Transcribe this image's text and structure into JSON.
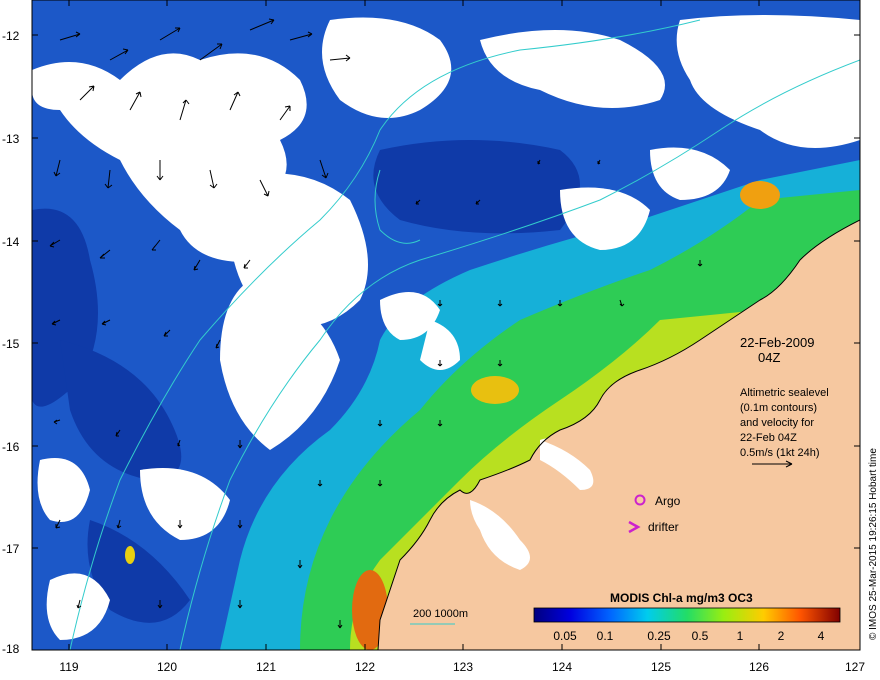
{
  "map": {
    "lon_ticks": [
      "119",
      "120",
      "121",
      "122",
      "123",
      "124",
      "125",
      "126",
      "127"
    ],
    "lat_ticks": [
      "-12",
      "-13",
      "-14",
      "-15",
      "-16",
      "-17",
      "-18"
    ],
    "date": "22-Feb-2009",
    "time": "04Z",
    "info_lines": [
      "Altimetric sealevel",
      "(0.1m contours)",
      "and velocity for",
      "22-Feb 04Z",
      "0.5m/s (1kt 24h)"
    ],
    "argo_label": "Argo",
    "drifter_label": "drifter",
    "bathy_label": "200  1000m",
    "colorbar": {
      "title": "MODIS Chl-a mg/m3 OC3",
      "ticks": [
        "0.05",
        "0.1",
        "0.25",
        "0.5",
        "1",
        "2",
        "4"
      ]
    },
    "credit": "© IMOS 25-Mar-2015 19:26:15 Hobart time",
    "colors": {
      "land": "#f6c8a0",
      "bathy_contour": "#33cccc",
      "argo": "#cc22cc",
      "cloud": "#ffffff"
    }
  }
}
